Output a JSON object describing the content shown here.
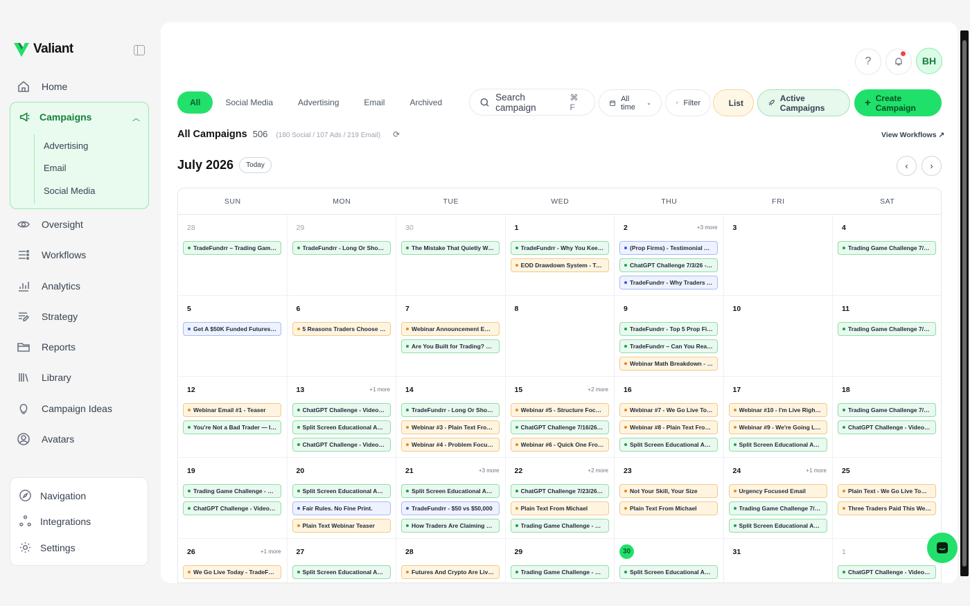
{
  "brand": {
    "name": "Valiant"
  },
  "sidebar": {
    "items": [
      {
        "label": "Home",
        "icon": "home-icon"
      },
      {
        "label": "Oversight",
        "icon": "eye-icon"
      },
      {
        "label": "Workflows",
        "icon": "workflow-icon"
      },
      {
        "label": "Analytics",
        "icon": "bar-chart-icon"
      },
      {
        "label": "Strategy",
        "icon": "strategy-icon"
      },
      {
        "label": "Reports",
        "icon": "folder-icon"
      },
      {
        "label": "Library",
        "icon": "library-icon"
      },
      {
        "label": "Campaign Ideas",
        "icon": "lightbulb-icon"
      },
      {
        "label": "Avatars",
        "icon": "user-circle-icon"
      }
    ],
    "campaigns": {
      "label": "Campaigns",
      "children": [
        "Advertising",
        "Email",
        "Social Media"
      ]
    },
    "bottom": [
      {
        "label": "Navigation",
        "icon": "compass-icon"
      },
      {
        "label": "Integrations",
        "icon": "integrations-icon"
      },
      {
        "label": "Settings",
        "icon": "gear-icon"
      }
    ]
  },
  "header": {
    "avatar": "BH",
    "help": "?"
  },
  "tabs": [
    "All",
    "Social Media",
    "Advertising",
    "Email",
    "Archived"
  ],
  "search": {
    "placeholder": "Search campaign",
    "shortcut": "⌘ F"
  },
  "toolbar": {
    "time": "All time",
    "filter": "Filter",
    "list": "List",
    "active": "Active Campaigns",
    "create": "Create Campaign"
  },
  "summary": {
    "title": "All Campaigns",
    "count": "506",
    "breakdown": "(180 Social / 107 Ads / 219 Email)",
    "view_workflows": "View Workflows"
  },
  "calendar": {
    "month": "July 2026",
    "today_label": "Today",
    "weekdays": [
      "SUN",
      "MON",
      "TUE",
      "WED",
      "THU",
      "FRI",
      "SAT"
    ],
    "weeks": [
      [
        {
          "day": "28",
          "muted": true,
          "events": [
            {
              "t": "TradeFundrr – Trading Game C...",
              "c": "g"
            }
          ]
        },
        {
          "day": "29",
          "muted": true,
          "events": [
            {
              "t": "TradeFundrr - Long Or Short #2",
              "c": "g"
            }
          ]
        },
        {
          "day": "30",
          "muted": true,
          "events": [
            {
              "t": "The Mistake That Quietly Wrec...",
              "c": "g"
            }
          ]
        },
        {
          "day": "1",
          "events": [
            {
              "t": "TradeFundrr - Why You Keep L...",
              "c": "g"
            },
            {
              "t": "EOD Drawdown System - Trad...",
              "c": "o"
            }
          ]
        },
        {
          "day": "2",
          "more": "+3 more",
          "events": [
            {
              "t": "(Prop Firms) - Testimonial Angl...",
              "c": "b"
            },
            {
              "t": "ChatGPT Challenge 7/3/26 - S...",
              "c": "g"
            },
            {
              "t": "TradeFundrr - Why Traders Are...",
              "c": "b"
            }
          ]
        },
        {
          "day": "3",
          "events": []
        },
        {
          "day": "4",
          "events": [
            {
              "t": "Trading Game Challenge 7/5/2...",
              "c": "g"
            }
          ]
        }
      ],
      [
        {
          "day": "5",
          "events": [
            {
              "t": "Get A $50K Funded Futures Ac...",
              "c": "b"
            }
          ]
        },
        {
          "day": "6",
          "events": [
            {
              "t": "5 Reasons Traders Choose Tra...",
              "c": "o"
            }
          ]
        },
        {
          "day": "7",
          "events": [
            {
              "t": "Webinar Announcement Email ...",
              "c": "o"
            },
            {
              "t": "Are You Built for Trading? Chart...",
              "c": "g"
            }
          ]
        },
        {
          "day": "8",
          "events": []
        },
        {
          "day": "9",
          "events": [
            {
              "t": "TradeFundrr - Top 5 Prop Firm ...",
              "c": "g"
            },
            {
              "t": "TradeFundrr – Can You Read a ...",
              "c": "g"
            },
            {
              "t": "Webinar Math Breakdown - Tra...",
              "c": "o"
            }
          ]
        },
        {
          "day": "10",
          "events": []
        },
        {
          "day": "11",
          "events": [
            {
              "t": "Trading Game Challenge 7/12/2...",
              "c": "g"
            }
          ]
        }
      ],
      [
        {
          "day": "12",
          "events": [
            {
              "t": "Webinar Email #1 - Teaser",
              "c": "o"
            },
            {
              "t": "You're Not a Bad Trader — It's ...",
              "c": "g"
            }
          ]
        },
        {
          "day": "13",
          "more": "+1 more",
          "events": [
            {
              "t": "ChatGPT Challenge - Video 7/1...",
              "c": "g"
            },
            {
              "t": "Split Screen Educational Advic...",
              "c": "g"
            },
            {
              "t": "ChatGPT Challenge - Video 7/1...",
              "c": "g"
            }
          ]
        },
        {
          "day": "14",
          "events": [
            {
              "t": "TradeFundrr - Long Or Short? #3",
              "c": "g"
            },
            {
              "t": "Webinar #3 - Plain Text From C...",
              "c": "o"
            },
            {
              "t": "Webinar #4 - Problem Focused",
              "c": "o"
            }
          ]
        },
        {
          "day": "15",
          "more": "+2 more",
          "events": [
            {
              "t": "Webinar #5 - Structure Focused",
              "c": "o"
            },
            {
              "t": "ChatGPT Challenge 7/16/26 - S...",
              "c": "g"
            },
            {
              "t": "Webinar #6 - Quick One From ...",
              "c": "o"
            }
          ]
        },
        {
          "day": "16",
          "events": [
            {
              "t": "Webinar #7 - We Go Live Tomo...",
              "c": "o"
            },
            {
              "t": "Webinar #8 - Plain Text From C...",
              "c": "o"
            },
            {
              "t": "Split Screen Educational Advic...",
              "c": "g"
            }
          ]
        },
        {
          "day": "17",
          "events": [
            {
              "t": "Webinar #10 - I'm Live Right Now",
              "c": "o"
            },
            {
              "t": "Webinar #9 - We're Going Live ...",
              "c": "o"
            },
            {
              "t": "Split Screen Educational Advic...",
              "c": "g"
            }
          ]
        },
        {
          "day": "18",
          "events": [
            {
              "t": "Trading Game Challenge 7/19/2...",
              "c": "g"
            },
            {
              "t": "ChatGPT Challenge - Video 7/1...",
              "c": "g"
            }
          ]
        }
      ],
      [
        {
          "day": "19",
          "events": [
            {
              "t": "Trading Game Challenge - Vide...",
              "c": "g"
            },
            {
              "t": "ChatGPT Challenge - Video 7/2...",
              "c": "g"
            }
          ]
        },
        {
          "day": "20",
          "events": [
            {
              "t": "Split Screen Educational Advic...",
              "c": "g"
            },
            {
              "t": "Fair Rules. No Fine Print.",
              "c": "b"
            },
            {
              "t": "Plain Text Webinar Teaser",
              "c": "o"
            }
          ]
        },
        {
          "day": "21",
          "more": "+3 more",
          "events": [
            {
              "t": "Split Screen Educational Advic...",
              "c": "g"
            },
            {
              "t": "TradeFundrr - $50 vs $50,000",
              "c": "b"
            },
            {
              "t": "How Traders Are Claiming $25...",
              "c": "g"
            }
          ]
        },
        {
          "day": "22",
          "more": "+2 more",
          "events": [
            {
              "t": "ChatGPT Challenge 7/23/26 - ...",
              "c": "g"
            },
            {
              "t": "Plain Text From Michael",
              "c": "o"
            },
            {
              "t": "Trading Game Challenge - Vide...",
              "c": "g"
            }
          ]
        },
        {
          "day": "23",
          "events": [
            {
              "t": "Not Your Skill, Your Size",
              "c": "o"
            },
            {
              "t": "Plain Text From Michael",
              "c": "o"
            }
          ]
        },
        {
          "day": "24",
          "more": "+1 more",
          "events": [
            {
              "t": "Urgency Focused Email",
              "c": "o"
            },
            {
              "t": "Trading Game Challenge 7/25/...",
              "c": "g"
            },
            {
              "t": "Split Screen Educational Advic...",
              "c": "g"
            }
          ]
        },
        {
          "day": "25",
          "events": [
            {
              "t": "Plain Text - We Go Live Tomorr...",
              "c": "o"
            },
            {
              "t": "Three Traders Paid This Week",
              "c": "o"
            }
          ]
        }
      ],
      [
        {
          "day": "26",
          "more": "+1 more",
          "events": [
            {
              "t": "We Go Live Today - TradeFundrr",
              "c": "o"
            }
          ]
        },
        {
          "day": "27",
          "events": [
            {
              "t": "Split Screen Educational Advic...",
              "c": "g"
            }
          ]
        },
        {
          "day": "28",
          "events": [
            {
              "t": "Futures And Crypto Are Live - T...",
              "c": "o"
            }
          ]
        },
        {
          "day": "29",
          "events": [
            {
              "t": "Trading Game Challenge - Vide...",
              "c": "g"
            }
          ]
        },
        {
          "day": "30",
          "today": true,
          "events": [
            {
              "t": "Split Screen Educational Advic...",
              "c": "g"
            }
          ]
        },
        {
          "day": "31",
          "events": []
        },
        {
          "day": "1",
          "muted": true,
          "events": [
            {
              "t": "ChatGPT Challenge - Video 8/2...",
              "c": "g"
            }
          ]
        }
      ]
    ]
  },
  "colors": {
    "accent": "#22e06b",
    "accent_dark": "#16803d",
    "orange": "#ea8a14",
    "blue": "#3b5bdb"
  }
}
